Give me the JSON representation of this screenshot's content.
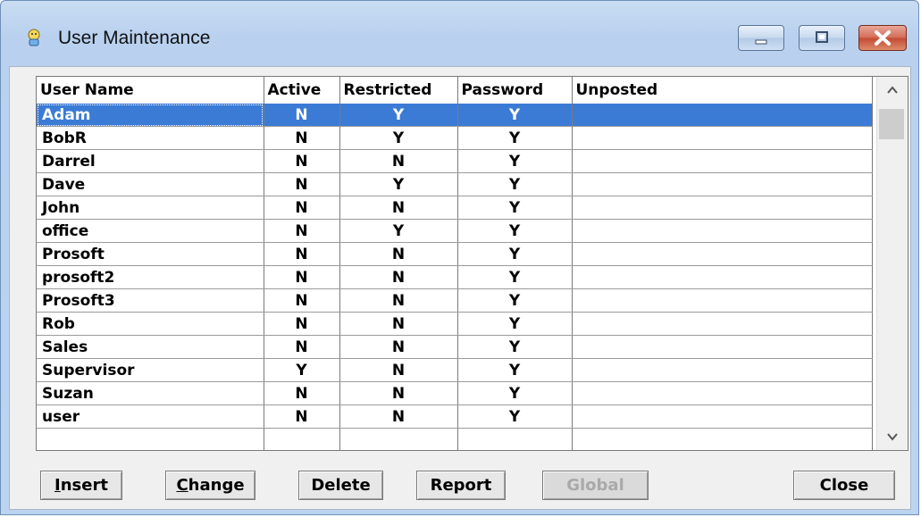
{
  "window": {
    "title": "User Maintenance"
  },
  "table": {
    "columns": [
      "User Name",
      "Active",
      "Restricted",
      "Password",
      "Unposted"
    ],
    "rows": [
      {
        "user": "Adam",
        "active": "N",
        "restricted": "Y",
        "password": "Y",
        "unposted": "",
        "selected": true
      },
      {
        "user": "BobR",
        "active": "N",
        "restricted": "Y",
        "password": "Y",
        "unposted": ""
      },
      {
        "user": "Darrel",
        "active": "N",
        "restricted": "N",
        "password": "Y",
        "unposted": ""
      },
      {
        "user": "Dave",
        "active": "N",
        "restricted": "Y",
        "password": "Y",
        "unposted": ""
      },
      {
        "user": "John",
        "active": "N",
        "restricted": "N",
        "password": "Y",
        "unposted": ""
      },
      {
        "user": "office",
        "active": "N",
        "restricted": "Y",
        "password": "Y",
        "unposted": ""
      },
      {
        "user": "Prosoft",
        "active": "N",
        "restricted": "N",
        "password": "Y",
        "unposted": ""
      },
      {
        "user": "prosoft2",
        "active": "N",
        "restricted": "N",
        "password": "Y",
        "unposted": ""
      },
      {
        "user": "Prosoft3",
        "active": "N",
        "restricted": "N",
        "password": "Y",
        "unposted": ""
      },
      {
        "user": "Rob",
        "active": "N",
        "restricted": "N",
        "password": "Y",
        "unposted": ""
      },
      {
        "user": "Sales",
        "active": "N",
        "restricted": "N",
        "password": "Y",
        "unposted": ""
      },
      {
        "user": "Supervisor",
        "active": "Y",
        "restricted": "N",
        "password": "Y",
        "unposted": ""
      },
      {
        "user": "Suzan",
        "active": "N",
        "restricted": "N",
        "password": "Y",
        "unposted": ""
      },
      {
        "user": "user",
        "active": "N",
        "restricted": "N",
        "password": "Y",
        "unposted": ""
      }
    ]
  },
  "buttons": {
    "insert": {
      "label": "Insert",
      "mnemonic": "I"
    },
    "change": {
      "label": "Change",
      "mnemonic": "C"
    },
    "delete": {
      "label": "Delete"
    },
    "report": {
      "label": "Report"
    },
    "global": {
      "label": "Global",
      "disabled": true
    },
    "close": {
      "label": "Close"
    }
  },
  "colors": {
    "selection": "#3b7bd6",
    "window_frame": "#bcd4f0",
    "close_button": "#c24a33"
  },
  "icons": {
    "app": "user-maintenance-app-icon",
    "minimize": "minimize-icon",
    "maximize": "maximize-icon",
    "close": "close-icon",
    "scroll_up": "chevron-up-icon",
    "scroll_down": "chevron-down-icon"
  }
}
